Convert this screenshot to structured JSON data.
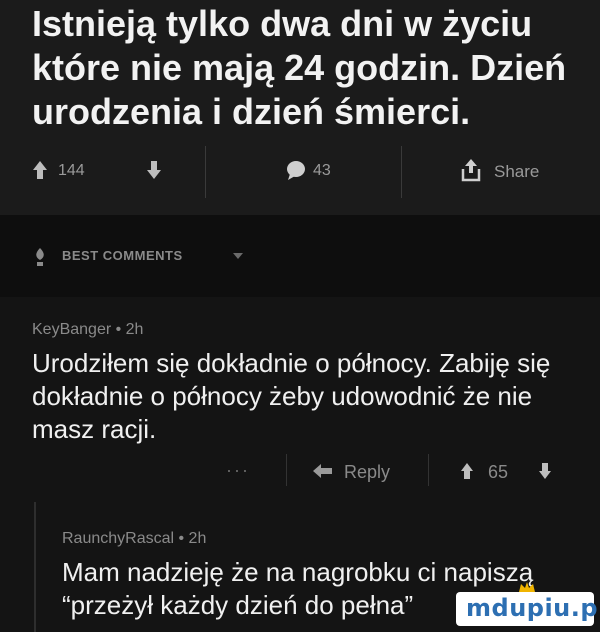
{
  "post": {
    "title": "Istnieją tylko dwa dni w życiu które nie mają 24 godzin. Dzień urodzenia i dzień śmierci.",
    "upvotes": "144",
    "comments": "43",
    "share_label": "Share"
  },
  "comments_section": {
    "label": "BEST COMMENTS"
  },
  "comments": [
    {
      "meta": "KeyBanger • 2h",
      "text": "Urodziłem się dokładnie o północy. Zabiję się dokładnie o północy żeby udowodnić że nie masz racji.",
      "more": "···",
      "reply_label": "Reply",
      "votes": "65"
    },
    {
      "meta": "RaunchyRascal • 2h",
      "text": "Mam nadzieję że na nagrobku ci napiszą “przeżył każdy dzień do pełna”"
    }
  ],
  "watermark": {
    "text": "mdupiu.pl"
  },
  "colors": {
    "background": "#141414",
    "post_background": "#1b1b1b",
    "text": "#f0f0f0",
    "muted": "#8a8a8a",
    "watermark_blue": "#2d6fb2"
  }
}
